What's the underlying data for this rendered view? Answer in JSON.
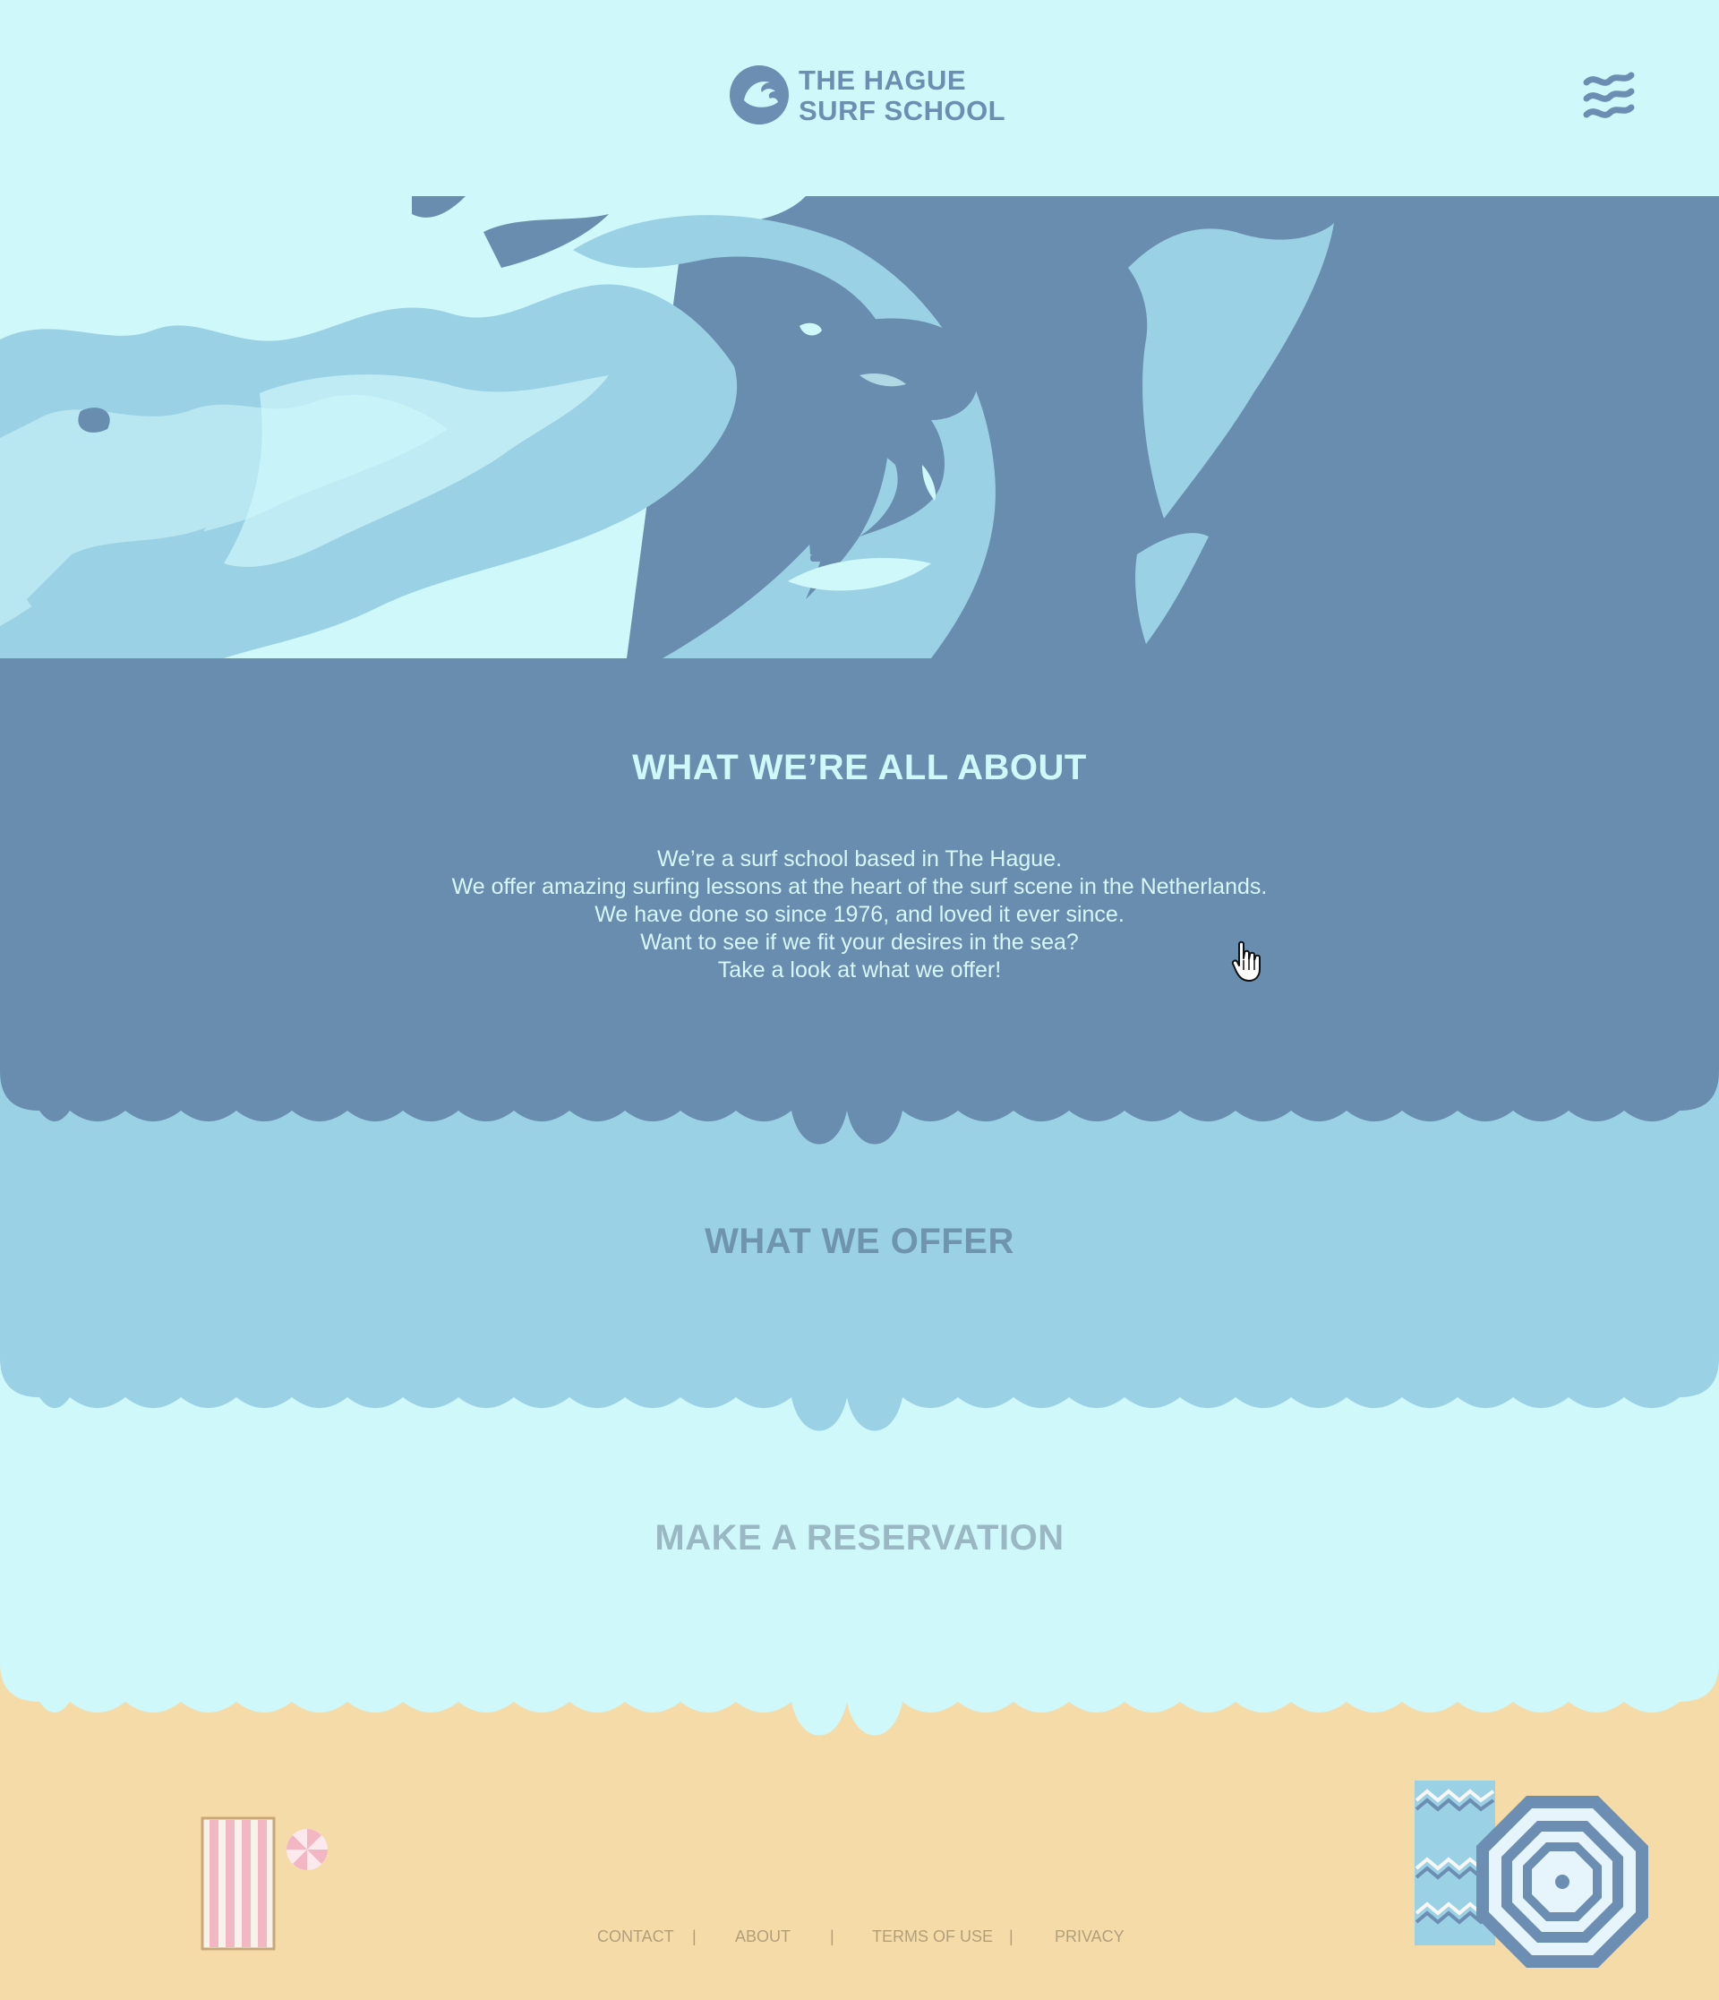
{
  "header": {
    "logo_line1": "THE HAGUE",
    "logo_line2": "SURF SCHOOL"
  },
  "about": {
    "title": "WHAT WE’RE ALL ABOUT",
    "lines": [
      "We’re a surf school based in The Hague.",
      "We offer amazing surfing lessons at the heart of the surf scene in the Netherlands.",
      "We have done so since 1976, and loved it ever since.",
      "Want to see if we fit your desires in the sea?",
      "Take a look at what we offer!"
    ]
  },
  "offer": {
    "title": "WHAT WE OFFER"
  },
  "reservation": {
    "title": "MAKE A RESERVATION"
  },
  "footer": {
    "links": [
      "CONTACT",
      "ABOUT",
      "TERMS OF USE",
      "PRIVACY"
    ],
    "separator": "|"
  },
  "colors": {
    "background": "#cff8fb",
    "dark_blue": "#688daf",
    "mid_blue": "#9bd1e4",
    "sand": "#f5dba8",
    "towel_stripe": "#f3b6c3",
    "umbrella_blue": "#6b8eb2"
  },
  "icons": [
    "logo-wave-icon",
    "menu-waves-icon",
    "hand-cursor-icon",
    "beach-umbrella-icon",
    "beach-ball-icon",
    "towel-icon"
  ]
}
